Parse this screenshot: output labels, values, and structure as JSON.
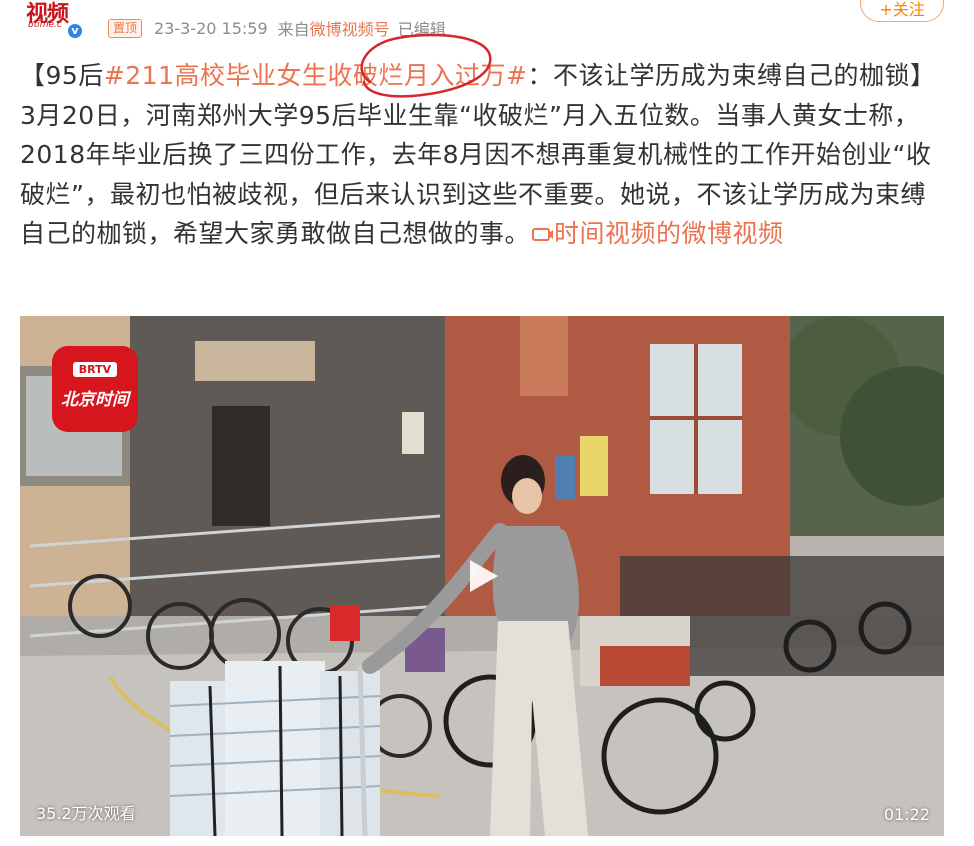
{
  "header": {
    "avatar_brand": "视频",
    "avatar_sub": "btime.c",
    "verified_mark": "v",
    "pin_badge": "置顶",
    "time": "23-3-20 15:59",
    "source_prefix": "来自",
    "source_name": "微博视频号",
    "edited": "已编辑",
    "follow_label": "+关注"
  },
  "post": {
    "bracket_open": "【95后",
    "hashtag": "#211高校毕业女生收破烂月入过万#",
    "title_rest": "：不该让学历成为束缚自己的枷锁】",
    "body": "3月20日，河南郑州大学95后毕业生靠“收破烂”月入五位数。当事人黄女士称，2018年毕业后换了三四份工作，去年8月因不想再重复机械性的工作开始创业“收破烂”，最初也怕被歧视，但后来认识到这些不重要。她说，不该让学历成为束缚自己的枷锁，希望大家勇敢做自己想做的事。",
    "video_link_icon": "video-link-icon",
    "video_link": "时间视频的微博视频"
  },
  "video": {
    "logo_tv": "BRTV",
    "logo_name": "北京时间",
    "views": "35.2万次观看",
    "duration": "01:22"
  },
  "colors": {
    "accent": "#eb7350",
    "text": "#333333",
    "meta": "#8c8c8c",
    "follow": "#ff8200",
    "annotation": "#d8262e"
  }
}
